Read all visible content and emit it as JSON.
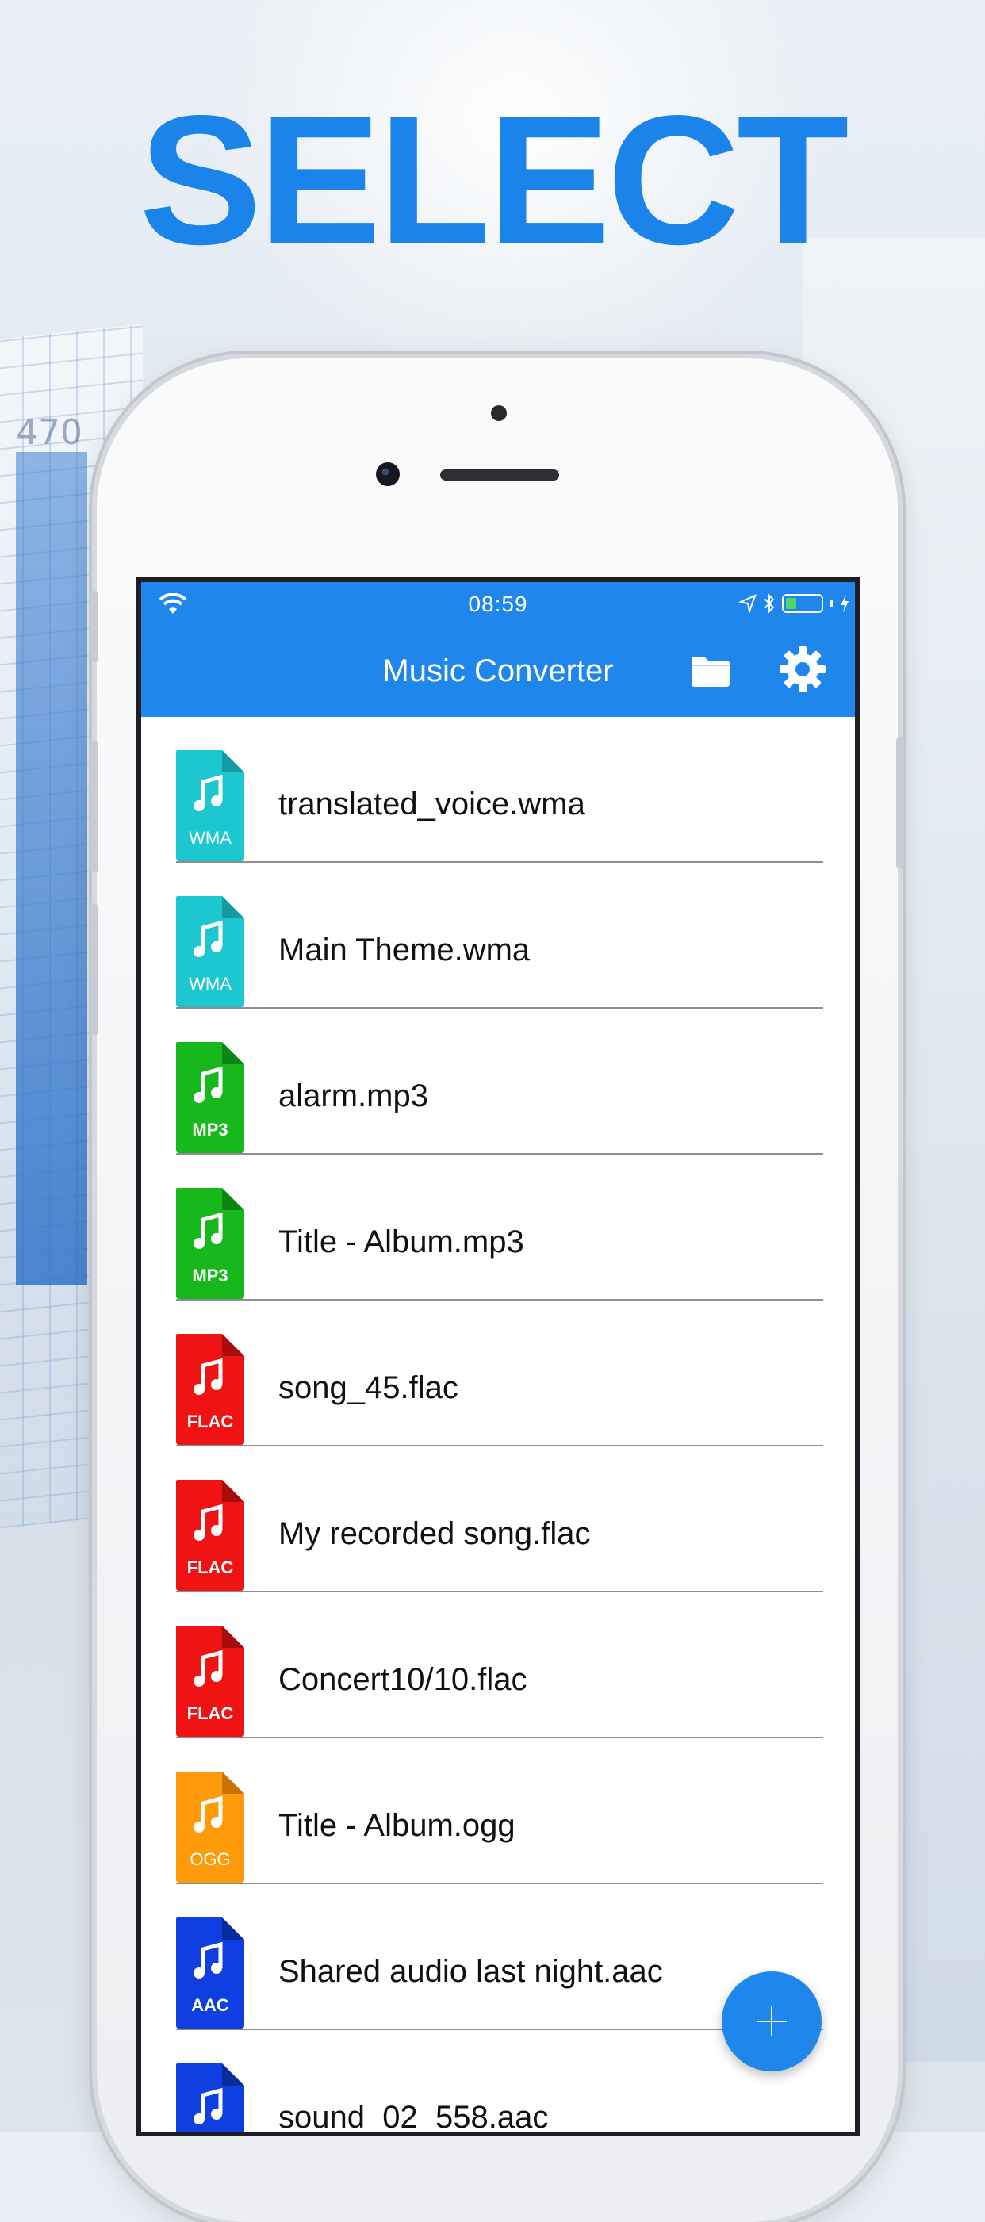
{
  "headline": "SELECT",
  "background": {
    "chart_tick": "470"
  },
  "status_bar": {
    "time": "08:59"
  },
  "app": {
    "title": "Music Converter",
    "accent_color": "#1f86ec",
    "toolbar_icons": [
      "folder-icon",
      "gear-icon"
    ]
  },
  "files": [
    {
      "name": "translated_voice.wma",
      "format": "WMA",
      "color": "#1cc7cf",
      "fold": "#159aa1"
    },
    {
      "name": "Main Theme.wma",
      "format": "WMA",
      "color": "#1cc7cf",
      "fold": "#159aa1"
    },
    {
      "name": "alarm.mp3",
      "format": "MP3",
      "color": "#16b81b",
      "fold": "#0e8412"
    },
    {
      "name": "Title  - Album.mp3",
      "format": "MP3",
      "color": "#16b81b",
      "fold": "#0e8412"
    },
    {
      "name": "song_45.flac",
      "format": "FLAC",
      "color": "#ef1313",
      "fold": "#a90c0c"
    },
    {
      "name": "My recorded song.flac",
      "format": "FLAC",
      "color": "#ef1313",
      "fold": "#a90c0c"
    },
    {
      "name": "Concert10/10.flac",
      "format": "FLAC",
      "color": "#ef1313",
      "fold": "#a90c0c"
    },
    {
      "name": "Title - Album.ogg",
      "format": "OGG",
      "color": "#ff9a0a",
      "fold": "#c87404"
    },
    {
      "name": "Shared audio last night.aac",
      "format": "AAC",
      "color": "#0f3fe0",
      "fold": "#0a2aa0"
    },
    {
      "name": "sound_02_558.aac",
      "format": "AAC",
      "color": "#0f3fe0",
      "fold": "#0a2aa0"
    }
  ],
  "fab": {
    "icon": "plus-icon"
  }
}
